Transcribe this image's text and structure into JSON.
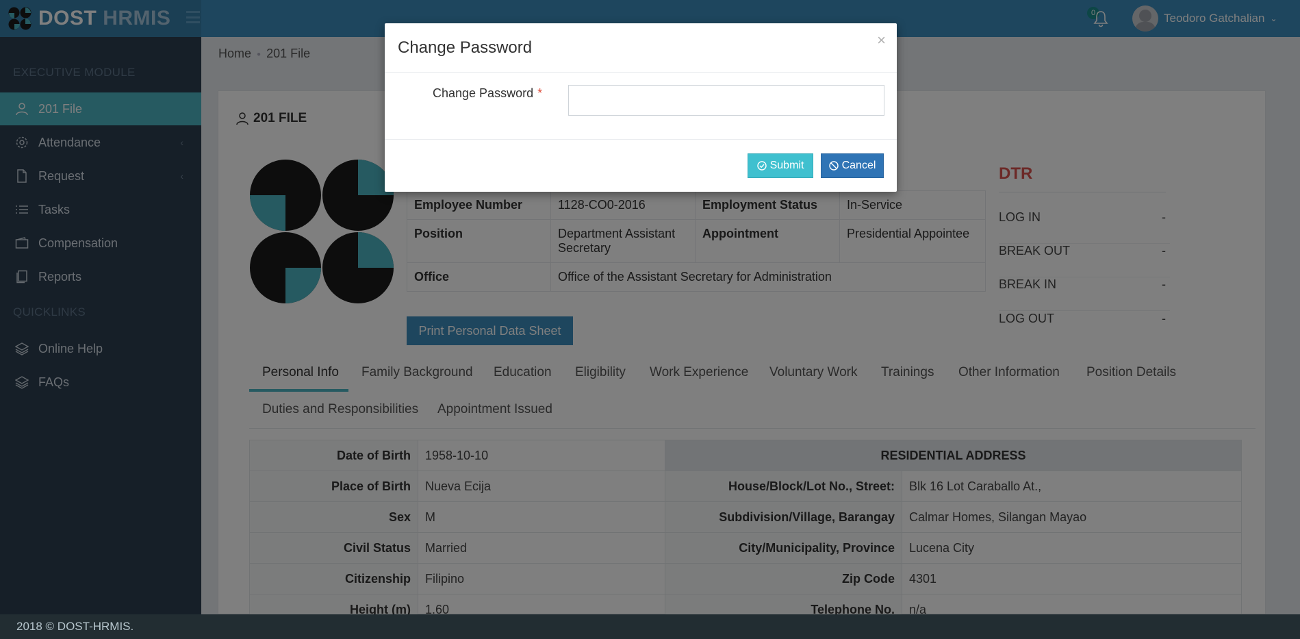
{
  "header": {
    "logo_main": "DOST",
    "logo_sub": "HRMIS",
    "notifications_count": "0",
    "user_name": "Teodoro Gatchalian"
  },
  "sidebar": {
    "section1": "EXECUTIVE MODULE",
    "items": [
      {
        "label": "201 File",
        "icon": "user-icon",
        "active": true
      },
      {
        "label": "Attendance",
        "icon": "gear-icon"
      },
      {
        "label": "Request",
        "icon": "document-icon"
      },
      {
        "label": "Tasks",
        "icon": "list-icon"
      },
      {
        "label": "Compensation",
        "icon": "wallet-icon"
      },
      {
        "label": "Reports",
        "icon": "clipboard-icon"
      }
    ],
    "section2": "QUICKLINKS",
    "links": [
      {
        "label": "Online Help",
        "icon": "layers-icon"
      },
      {
        "label": "FAQs",
        "icon": "layers-icon"
      }
    ]
  },
  "breadcrumb": {
    "home": "Home",
    "current": "201 File"
  },
  "panel": {
    "title": "201 FILE"
  },
  "employee": {
    "number_label": "Employee Number",
    "number": "1128-CO0-2016",
    "status_label": "Employment Status",
    "status": "In-Service",
    "position_label": "Position",
    "position": "Department Assistant Secretary",
    "appointment_label": "Appointment",
    "appointment": "Presidential Appointee",
    "office_label": "Office",
    "office": "Office of the Assistant Secretary for Administration",
    "print_button": "Print Personal Data Sheet"
  },
  "dtr": {
    "title": "DTR",
    "rows": [
      {
        "label": "LOG IN",
        "value": "-"
      },
      {
        "label": "BREAK OUT",
        "value": "-"
      },
      {
        "label": "BREAK IN",
        "value": "-"
      },
      {
        "label": "LOG OUT",
        "value": "-"
      }
    ]
  },
  "tabs": [
    "Personal Info",
    "Family Background",
    "Education",
    "Eligibility",
    "Work Experience",
    "Voluntary Work",
    "Trainings",
    "Other Information",
    "Position Details",
    "Duties and Responsibilities",
    "Appointment Issued"
  ],
  "personal": {
    "residential_header": "RESIDENTIAL ADDRESS",
    "rows": [
      {
        "l1": "Date of Birth",
        "v1": "1958-10-10"
      },
      {
        "l1": "Place of Birth",
        "v1": "Nueva Ecija",
        "l2": "House/Block/Lot No., Street:",
        "v2": "Blk 16 Lot Caraballo At.,"
      },
      {
        "l1": "Sex",
        "v1": "M",
        "l2": "Subdivision/Village, Barangay",
        "v2": "Calmar Homes, Silangan Mayao"
      },
      {
        "l1": "Civil Status",
        "v1": "Married",
        "l2": "City/Municipality, Province",
        "v2": "Lucena City"
      },
      {
        "l1": "Citizenship",
        "v1": "Filipino",
        "l2": "Zip Code",
        "v2": "4301"
      },
      {
        "l1": "Height (m)",
        "v1": "1.60",
        "l2": "Telephone No.",
        "v2": "n/a"
      }
    ]
  },
  "footer": {
    "text": "2018 © DOST-HRMIS."
  },
  "modal": {
    "title": "Change Password",
    "close": "×",
    "field_label": "Change Password",
    "required_mark": "*",
    "field_value": "",
    "submit": "Submit",
    "cancel": "Cancel"
  },
  "colors": {
    "accent": "#4cb5c2",
    "header": "#3c8dbc",
    "sidebar": "#2c3e50",
    "dtr": "#d9534f"
  }
}
